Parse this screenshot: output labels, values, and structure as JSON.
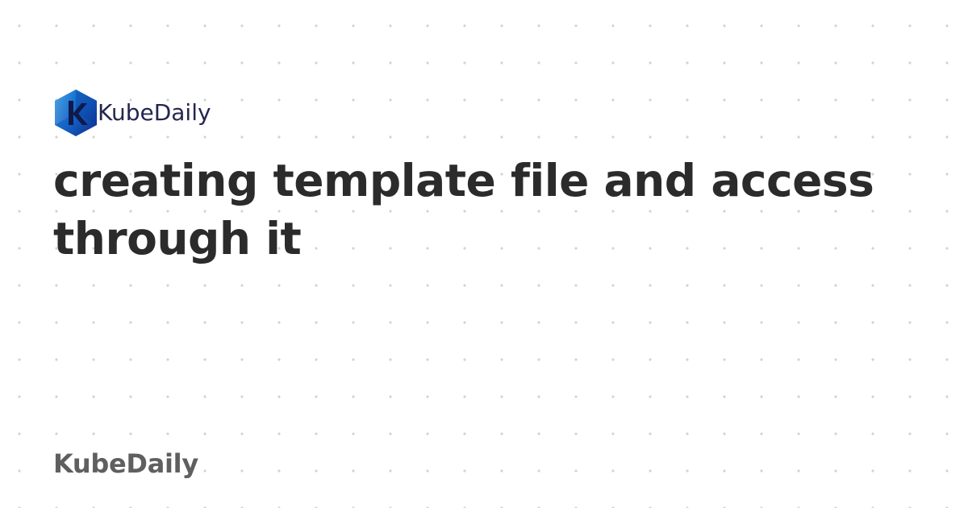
{
  "header": {
    "logo_icon": "kubedaily-hexagon-k-icon",
    "logo_text": "KubeDaily"
  },
  "post": {
    "title": "creating template file and access through it"
  },
  "footer": {
    "brand": "KubeDaily"
  },
  "colors": {
    "background": "#ffffff",
    "dots": "#d2d2d2",
    "title": "#2b2b2b",
    "logo_text": "#252552",
    "footer_brand": "#5f5f5f",
    "logo_gradient_start": "#1b7fd4",
    "logo_gradient_end": "#0b2a86"
  }
}
